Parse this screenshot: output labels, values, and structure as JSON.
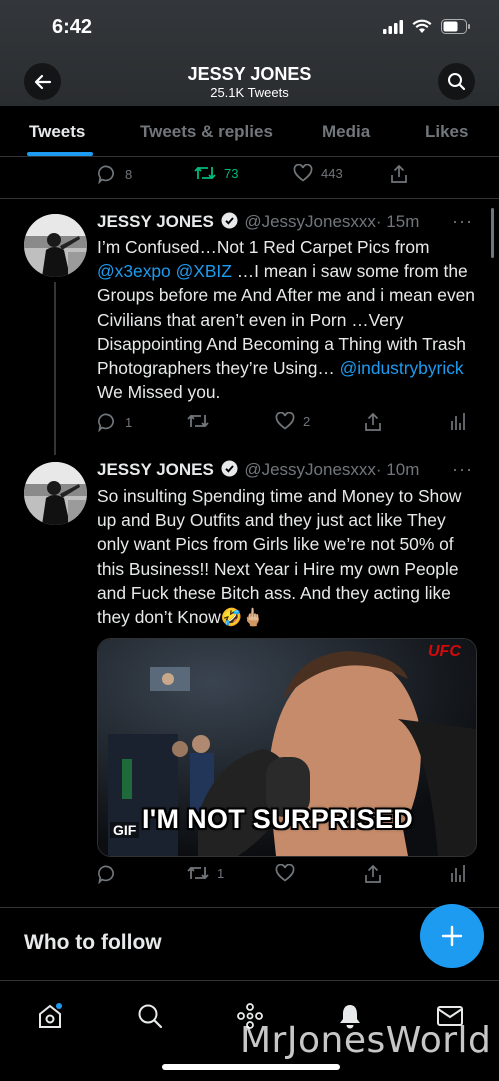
{
  "status_bar": {
    "time": "6:42"
  },
  "header": {
    "name": "JESSY JONES",
    "tweet_count": "25.1K Tweets",
    "back_icon": "arrow-left-icon",
    "search_icon": "search-icon"
  },
  "tabs": [
    {
      "label": "Tweets",
      "active": true
    },
    {
      "label": "Tweets & replies",
      "active": false
    },
    {
      "label": "Media",
      "active": false
    },
    {
      "label": "Likes",
      "active": false
    }
  ],
  "prev_tweet_actions": {
    "replies": "8",
    "retweets": "73",
    "likes": "443"
  },
  "tweets": [
    {
      "name": "JESSY JONES",
      "handle": "@JessyJonesxxx",
      "time": "· 15m",
      "text_parts": [
        "I’m Confused…Not 1 Red Carpet Pics from ",
        "@x3expo",
        " ",
        "@XBIZ",
        " …I mean i saw some from the Groups before me And After me and i mean even Civilians that aren’t even in Porn …Very Disappointing And Becoming a Thing with Trash Photographers they’re Using… ",
        "@industrybyrick",
        " We Missed you."
      ],
      "replies": "1",
      "retweets": "",
      "likes": "2"
    },
    {
      "name": "JESSY JONES",
      "handle": "@JessyJonesxxx",
      "time": "· 10m",
      "text": "So insulting Spending time and Money to Show up and Buy Outfits and they just act like They only want Pics from Girls like we’re not 50% of this Business!! Next Year i Hire my own People and Fuck these Bitch ass. And they acting like they don’t Know🤣🖕🏼",
      "gif_label": "GIF",
      "gif_caption": "I'M NOT SURPRISED",
      "gif_brand": "UFC",
      "replies": "",
      "retweets": "1",
      "likes": ""
    }
  ],
  "who_to_follow": "Who to follow",
  "watermark": "MrJonesWorld",
  "colors": {
    "accent": "#1d9bf0",
    "retweet": "#00ba7c",
    "muted": "#71767b"
  }
}
